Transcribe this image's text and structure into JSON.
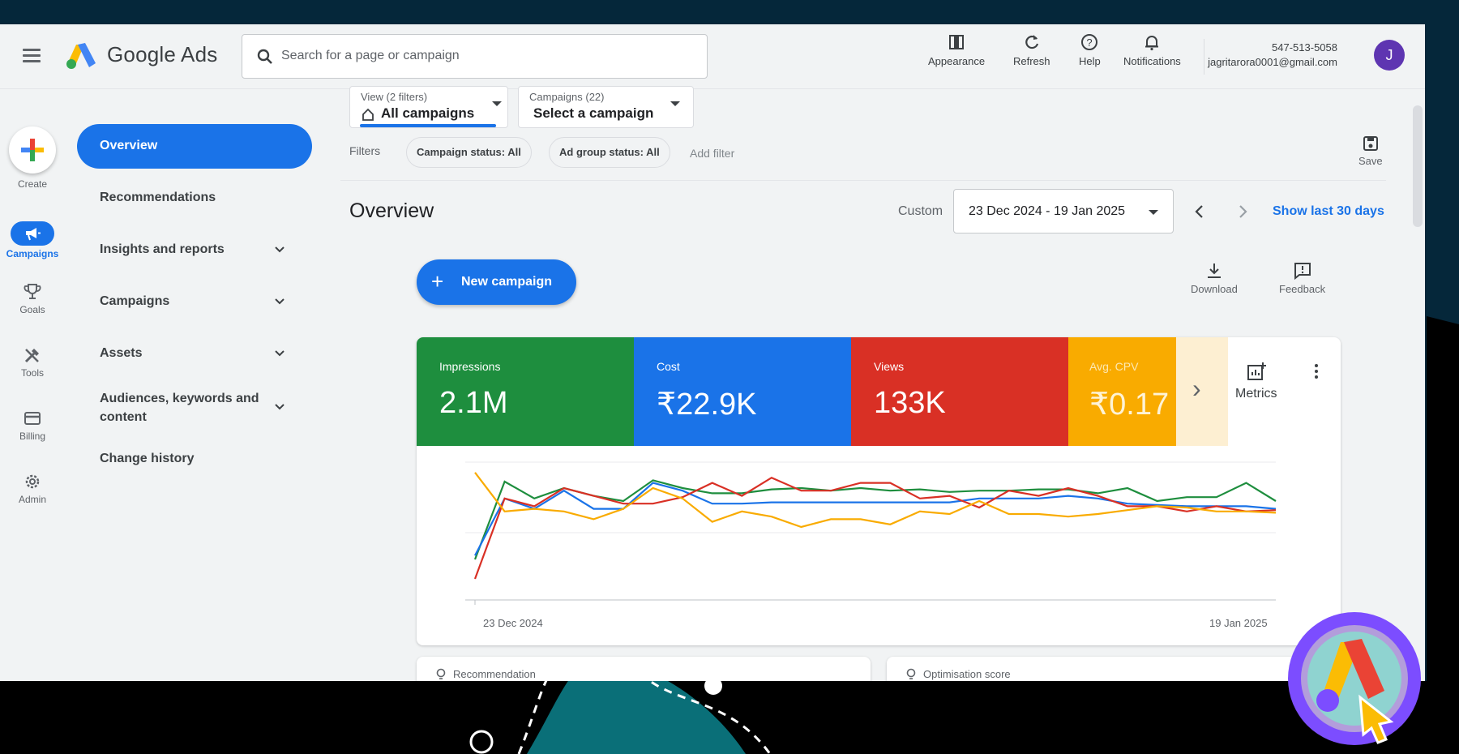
{
  "app": {
    "brand": "Google Ads",
    "search_placeholder": "Search for a page or campaign"
  },
  "topbar": {
    "tools": [
      {
        "label": "Appearance",
        "icon": "appearance-icon"
      },
      {
        "label": "Refresh",
        "icon": "refresh-icon"
      },
      {
        "label": "Help",
        "icon": "help-icon"
      },
      {
        "label": "Notifications",
        "icon": "bell-icon"
      }
    ],
    "account_id": "547-513-5058",
    "account_email": "jagritarora0001@gmail.com",
    "avatar_initial": "J"
  },
  "rail": {
    "create": "Create",
    "items": [
      {
        "label": "Campaigns",
        "icon": "megaphone-icon",
        "active": true
      },
      {
        "label": "Goals",
        "icon": "trophy-icon"
      },
      {
        "label": "Tools",
        "icon": "tools-icon"
      },
      {
        "label": "Billing",
        "icon": "card-icon"
      },
      {
        "label": "Admin",
        "icon": "gear-icon"
      }
    ]
  },
  "sidenav": {
    "items": [
      {
        "label": "Overview",
        "active": true
      },
      {
        "label": "Recommendations"
      },
      {
        "label": "Insights and reports",
        "expandable": true
      },
      {
        "label": "Campaigns",
        "expandable": true
      },
      {
        "label": "Assets",
        "expandable": true
      },
      {
        "label": "Audiences, keywords and content",
        "expandable": true
      },
      {
        "label": "Change history"
      }
    ]
  },
  "toolbar": {
    "view_small": "View (2 filters)",
    "view_value": "All campaigns",
    "campaigns_small": "Campaigns (22)",
    "campaigns_value": "Select a campaign",
    "filters_label": "Filters",
    "chips": [
      "Campaign status: All",
      "Ad group status: All"
    ],
    "add_filter": "Add filter",
    "save": "Save"
  },
  "overview": {
    "title": "Overview",
    "custom_label": "Custom",
    "date_range": "23 Dec 2024 - 19 Jan 2025",
    "show_last": "Show last 30 days",
    "new_campaign": "New campaign",
    "download": "Download",
    "feedback": "Feedback",
    "metrics_label": "Metrics"
  },
  "metrics": [
    {
      "label": "Impressions",
      "value": "2.1M",
      "color": "#1e8e3e"
    },
    {
      "label": "Cost",
      "value": "₹22.9K",
      "color": "#1a73e8"
    },
    {
      "label": "Views",
      "value": "133K",
      "color": "#d93025"
    },
    {
      "label": "Avg. CPV",
      "value": "₹0.17",
      "color": "#f9ab00"
    }
  ],
  "chart_data": {
    "type": "line",
    "x_start_label": "23 Dec 2024",
    "x_end_label": "19 Jan 2025",
    "grid": true,
    "series": [
      {
        "name": "Impressions",
        "color": "#1e8e3e",
        "values": [
          0.25,
          0.85,
          0.72,
          0.8,
          0.74,
          0.7,
          0.86,
          0.8,
          0.76,
          0.76,
          0.79,
          0.8,
          0.78,
          0.8,
          0.78,
          0.79,
          0.77,
          0.78,
          0.78,
          0.79,
          0.79,
          0.76,
          0.8,
          0.7,
          0.73,
          0.73,
          0.84,
          0.7
        ]
      },
      {
        "name": "Cost",
        "color": "#1a73e8",
        "values": [
          0.28,
          0.72,
          0.64,
          0.78,
          0.64,
          0.64,
          0.84,
          0.78,
          0.68,
          0.68,
          0.69,
          0.69,
          0.69,
          0.69,
          0.69,
          0.69,
          0.69,
          0.72,
          0.72,
          0.72,
          0.74,
          0.72,
          0.68,
          0.67,
          0.66,
          0.66,
          0.66,
          0.64
        ]
      },
      {
        "name": "Views",
        "color": "#d93025",
        "values": [
          0.1,
          0.72,
          0.66,
          0.8,
          0.74,
          0.68,
          0.68,
          0.73,
          0.84,
          0.74,
          0.88,
          0.78,
          0.78,
          0.84,
          0.84,
          0.72,
          0.74,
          0.65,
          0.78,
          0.74,
          0.8,
          0.74,
          0.66,
          0.66,
          0.62,
          0.66,
          0.62,
          0.63
        ]
      },
      {
        "name": "Avg. CPV",
        "color": "#f9ab00",
        "values": [
          0.92,
          0.62,
          0.64,
          0.62,
          0.56,
          0.64,
          0.8,
          0.72,
          0.54,
          0.62,
          0.58,
          0.5,
          0.56,
          0.56,
          0.52,
          0.62,
          0.6,
          0.7,
          0.6,
          0.6,
          0.58,
          0.6,
          0.63,
          0.66,
          0.65,
          0.62,
          0.62,
          0.61
        ]
      }
    ]
  },
  "subcards": {
    "left": "Recommendation",
    "right": "Optimisation score"
  }
}
